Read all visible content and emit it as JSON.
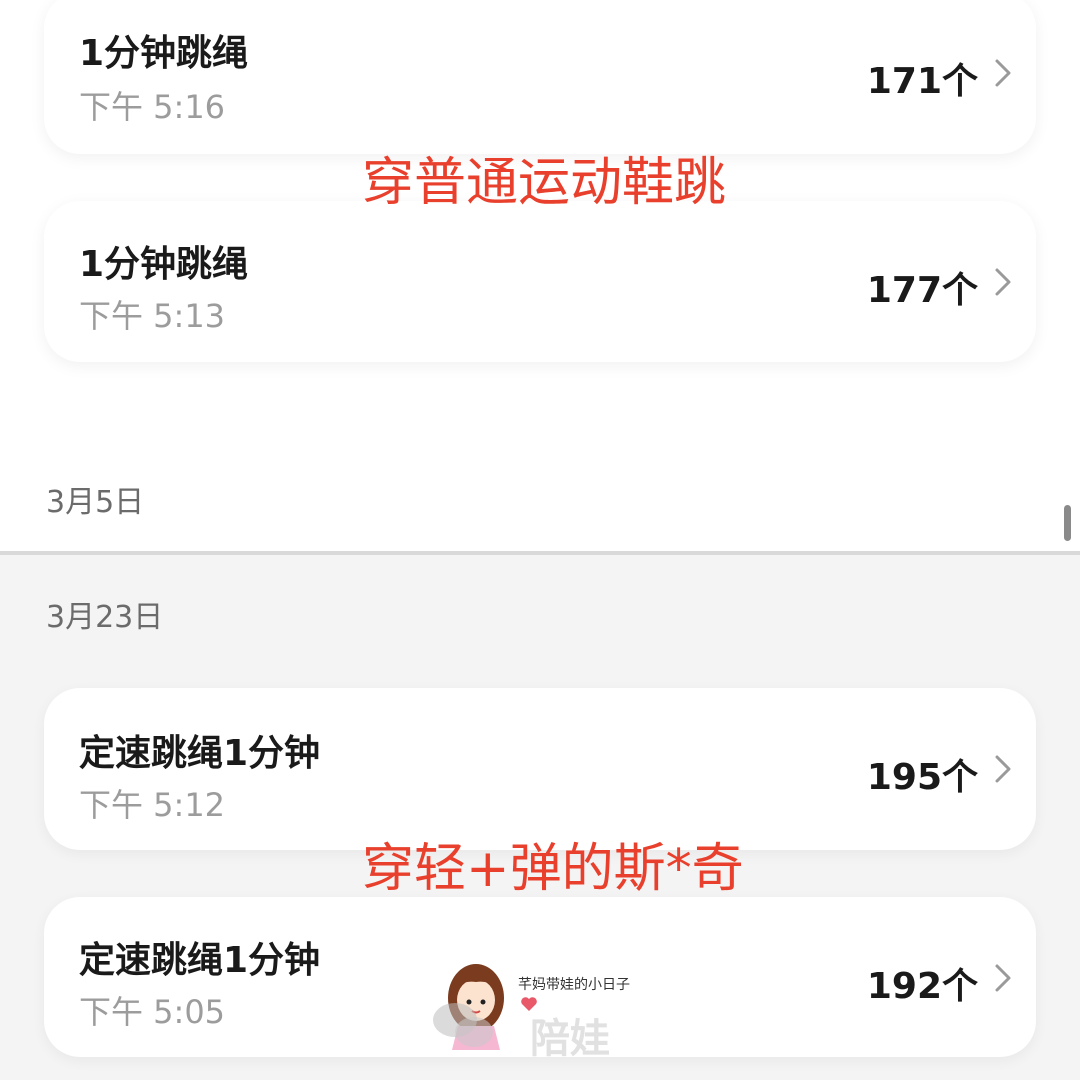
{
  "records_before": [
    {
      "title": "1分钟跳绳",
      "time": "下午 5:16",
      "count": "171个"
    },
    {
      "title": "1分钟跳绳",
      "time": "下午 5:13",
      "count": "177个"
    }
  ],
  "date_label_1": "3月5日",
  "date_label_2": "3月23日",
  "records_after": [
    {
      "title": "定速跳绳1分钟",
      "time": "下午 5:12",
      "count": "195个"
    },
    {
      "title": "定速跳绳1分钟",
      "time": "下午 5:05",
      "count": "192个"
    }
  ],
  "annotations": {
    "top": "穿普通运动鞋跳",
    "bottom": "穿轻+弹的斯*奇"
  },
  "watermark": {
    "caption": "芊妈带娃的小日子",
    "brand": "陪娃"
  },
  "colors": {
    "annotation": "#e8402c",
    "card": "#ffffff",
    "background": "#f4f4f4"
  }
}
